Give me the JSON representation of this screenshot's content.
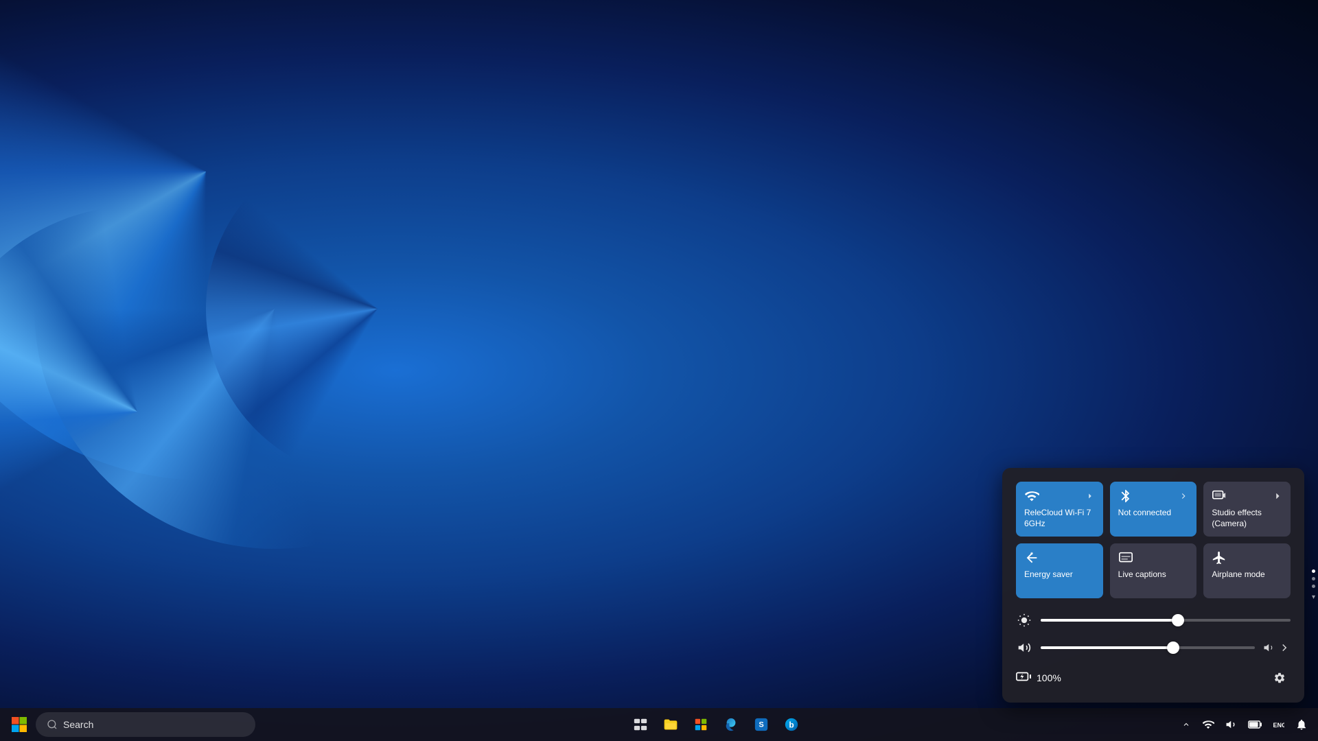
{
  "desktop": {
    "background_desc": "Windows 11 blue ribbons wallpaper"
  },
  "taskbar": {
    "search_placeholder": "Search",
    "start_label": "Start",
    "icons": [
      {
        "name": "task-view",
        "label": "Task View"
      },
      {
        "name": "file-explorer",
        "label": "File Explorer"
      },
      {
        "name": "microsoft-store",
        "label": "Microsoft Store"
      },
      {
        "name": "edge",
        "label": "Microsoft Edge"
      },
      {
        "name": "store-app",
        "label": "Store"
      },
      {
        "name": "bing-app",
        "label": "Bing"
      }
    ]
  },
  "quick_settings": {
    "tiles": [
      {
        "id": "wifi",
        "label": "ReleCloud Wi-Fi\n7 6GHz",
        "active": true,
        "has_arrow": true,
        "icon": "wifi"
      },
      {
        "id": "bluetooth",
        "label": "Not connected",
        "active": true,
        "has_arrow": true,
        "icon": "bluetooth"
      },
      {
        "id": "studio-effects",
        "label": "Studio effects\n(Camera)",
        "active": false,
        "has_arrow": true,
        "icon": "studio"
      },
      {
        "id": "energy-saver",
        "label": "Energy saver",
        "active": true,
        "has_arrow": false,
        "icon": "energy"
      },
      {
        "id": "live-captions",
        "label": "Live captions",
        "active": false,
        "has_arrow": false,
        "icon": "captions"
      },
      {
        "id": "airplane-mode",
        "label": "Airplane mode",
        "active": false,
        "has_arrow": false,
        "icon": "airplane"
      }
    ],
    "brightness": {
      "label": "Brightness",
      "value": 55,
      "percent": 55
    },
    "volume": {
      "label": "Volume",
      "value": 62,
      "percent": 62
    },
    "battery": {
      "label": "Battery",
      "percent": "100%",
      "charging": true
    }
  },
  "systray": {
    "chevron_label": "Show hidden icons",
    "wifi_label": "Wi-Fi",
    "volume_label": "Volume",
    "battery_label": "Battery",
    "language_label": "Language",
    "notification_label": "Notification center"
  }
}
